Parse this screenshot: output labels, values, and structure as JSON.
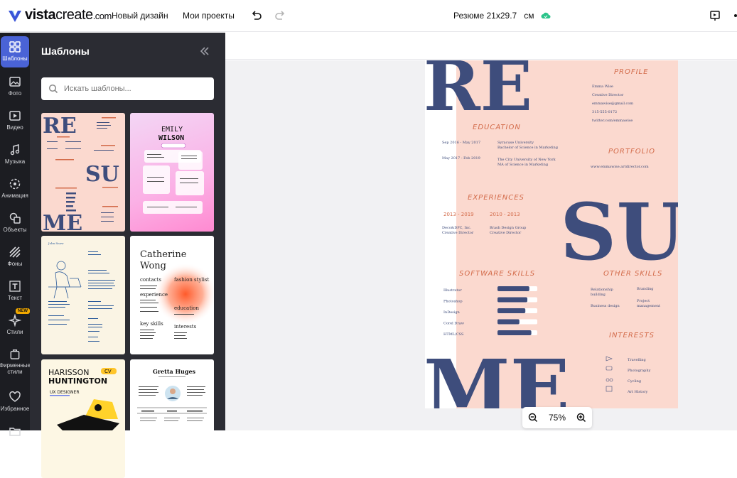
{
  "topbar": {
    "brand": "vista",
    "brand_bold": "create",
    "brand_dom": ".com",
    "new_design": "Новый дизайн",
    "my_projects": "Мои проекты",
    "doc_title": "Резюме 21x29.7",
    "doc_unit": "см"
  },
  "sidebar": {
    "items": [
      {
        "label": "Шаблоны",
        "icon": "templates-icon"
      },
      {
        "label": "Фото",
        "icon": "photo-icon"
      },
      {
        "label": "Видео",
        "icon": "video-icon"
      },
      {
        "label": "Музыка",
        "icon": "music-icon"
      },
      {
        "label": "Анимация",
        "icon": "animation-icon"
      },
      {
        "label": "Объекты",
        "icon": "objects-icon"
      },
      {
        "label": "Фоны",
        "icon": "backgrounds-icon"
      },
      {
        "label": "Текст",
        "icon": "text-icon"
      },
      {
        "label": "Стили",
        "icon": "styles-icon",
        "badge": "NEW"
      },
      {
        "label": "Фирменные стили",
        "icon": "brand-kit-icon"
      },
      {
        "label": "Избранное",
        "icon": "heart-icon"
      }
    ]
  },
  "panel": {
    "title": "Шаблоны",
    "search_placeholder": "Искать шаблоны...",
    "thumbs": [
      {
        "t1": "RE",
        "t2": "SU",
        "t3": "ME"
      },
      {
        "t1": "EMILY",
        "t2": "WILSON"
      },
      {
        "t1": "John Snow"
      },
      {
        "t1": "Catherine",
        "t2": "Wong",
        "t3": "fashion stylist",
        "t4": "contacts",
        "t5": "experience",
        "t6": "education",
        "t7": "key skills",
        "t8": "interests"
      },
      {
        "t1": "HARISSON",
        "t2": "HUNTINGTON",
        "t3": "UX DESIGNER",
        "t4": "CV"
      },
      {
        "t1": "Gretta Huges"
      }
    ]
  },
  "resume": {
    "big1": "RE",
    "big2": "SU",
    "big3": "ME",
    "profile_head": "PROFILE",
    "profile": [
      "Emma Wise",
      "Creative Director",
      "emmawise@gmail.com",
      "315-555-0172",
      "twitter.com/emmawise"
    ],
    "education_head": "EDUCATION",
    "edu": [
      {
        "date": "Sep 2016 - May 2017",
        "l1": "Syracuse University",
        "l2": "Bachelor of Science in Marketing"
      },
      {
        "date": "May 2017 - Feb 2019",
        "l1": "The City University of New York",
        "l2": "MA of Science in Marketing"
      }
    ],
    "portfolio_head": "PORTFOLIO",
    "portfolio": "www.emmawise.artdirector.com",
    "experiences_head": "EXPERIENCES",
    "exp": [
      {
        "years": "2013 - 2019",
        "l1": "Deco&DPC, Inc.",
        "l2": "Creative Director"
      },
      {
        "years": "2010 - 2013",
        "l1": "Brash Design Group",
        "l2": "Creative Director"
      }
    ],
    "software_head": "SOFTWARE SKILLS",
    "software": [
      {
        "name": "Illustrator",
        "level": 0.8
      },
      {
        "name": "Photoshop",
        "level": 0.75
      },
      {
        "name": "InDesign",
        "level": 0.7
      },
      {
        "name": "Corel Draw",
        "level": 0.55
      },
      {
        "name": "HTML/CSS",
        "level": 0.85
      }
    ],
    "other_head": "OTHER SKILLS",
    "other": [
      "Relationship",
      "building",
      "Business design",
      "Branding",
      "Project",
      "management"
    ],
    "interests_head": "INTERESTS",
    "interests": [
      "Travelling",
      "Photography",
      "Cycling",
      "Art History"
    ]
  },
  "zoom": {
    "value": "75%"
  },
  "colors": {
    "accent": "#4a63d6",
    "sidebar_bg": "#1c1d22",
    "panel_bg": "#2b2c33",
    "resume_pink": "#fbd9cf",
    "resume_blue": "#3e4d7c",
    "resume_orange": "#d36b4a"
  }
}
